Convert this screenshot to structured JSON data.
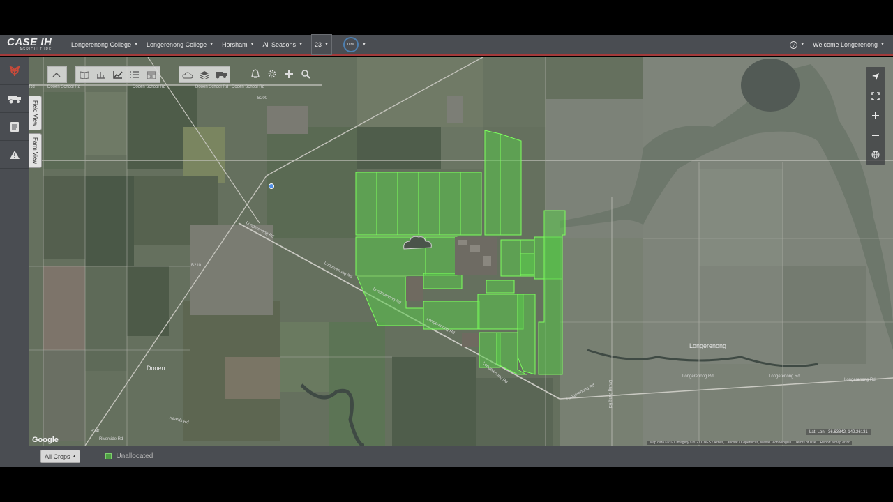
{
  "header": {
    "brand": "CASE IH",
    "brand_sub": "AGRICULTURE",
    "org": "Longerenong College",
    "farm": "Longerenong College",
    "location": "Horsham",
    "season": "All Seasons",
    "count": "23",
    "progress": "00%",
    "help_icon": "?",
    "welcome": "Welcome Longerenong"
  },
  "side_tabs": {
    "field_view": "Field View",
    "farm_view": "Farm View"
  },
  "map": {
    "roads": {
      "dooen_school_1": "Dooen School Rd",
      "dooen_school_2": "Dooen School Rd",
      "dooen_school_3": "Dooen School Rd",
      "rd_left": "Rd",
      "b200": "B200",
      "longerenong_1": "Longerenong Rd",
      "longerenong_2": "Longerenong Rd",
      "longerenong_3": "Longerenong Rd",
      "longerenong_4": "Longerenong Rd",
      "longerenong_5": "Longerenong Rd",
      "longerenong_6": "Longerenong Rd",
      "longerenong_7": "Longerenong Rd",
      "longerenong_8": "Longerenong Rd",
      "b210": "B210",
      "b240": "B240",
      "heards": "Heards Rd",
      "riverside": "Riverside Rd",
      "drung_jung": "Drung Jung Rd"
    },
    "towns": {
      "dooen": "Dooen",
      "longerenong": "Longerenong"
    },
    "google": "Google",
    "latlon": "Lat, Lon: -36.63842, 142.26131",
    "attribution": "Map data ©2021 Imagery ©2021 CNES / Airbus, Landsat / Copernicus, Maxar Technologies",
    "terms": "Terms of Use",
    "report": "Report a map error"
  },
  "legend": {
    "crop_filter": "All Crops",
    "unallocated": "Unallocated",
    "unallocated_color": "#4f9e44"
  },
  "colors": {
    "accent": "#a33a3a",
    "field_fill": "#59c94a",
    "field_stroke": "#7dff5e"
  }
}
